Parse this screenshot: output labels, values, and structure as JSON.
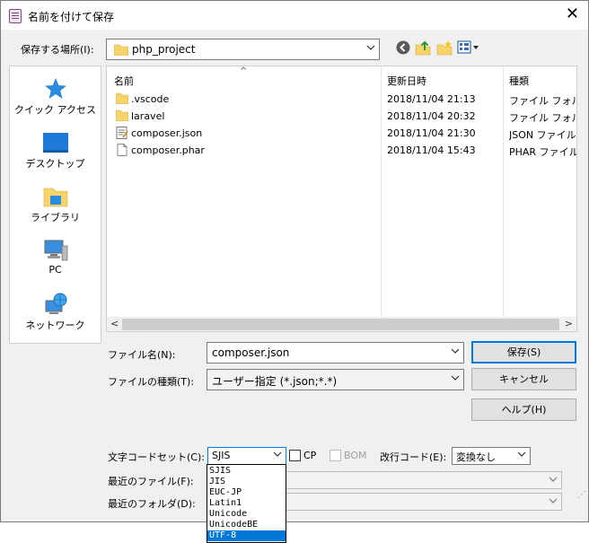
{
  "window": {
    "title": "名前を付けて保存",
    "close_glyph": "✕"
  },
  "location": {
    "label": "保存する場所(I):",
    "value": "php_project"
  },
  "places": [
    {
      "label": "クイック アクセス",
      "icon": "star-icon"
    },
    {
      "label": "デスクトップ",
      "icon": "desktop-icon"
    },
    {
      "label": "ライブラリ",
      "icon": "library-icon"
    },
    {
      "label": "PC",
      "icon": "computer-icon"
    },
    {
      "label": "ネットワーク",
      "icon": "network-icon"
    }
  ],
  "file_list": {
    "columns": [
      "名前",
      "更新日時",
      "種類"
    ],
    "rows": [
      {
        "name": ".vscode",
        "modified": "2018/11/04 21:13",
        "type": "ファイル フォルダー",
        "icon": "folder-icon"
      },
      {
        "name": "laravel",
        "modified": "2018/11/04 20:32",
        "type": "ファイル フォルダー",
        "icon": "folder-icon"
      },
      {
        "name": "composer.json",
        "modified": "2018/11/04 21:30",
        "type": "JSON ファイル",
        "icon": "json-file-icon"
      },
      {
        "name": "composer.phar",
        "modified": "2018/11/04 15:43",
        "type": "PHAR ファイル",
        "icon": "file-icon"
      }
    ]
  },
  "filename": {
    "label": "ファイル名(N):",
    "value": "composer.json"
  },
  "filetype": {
    "label": "ファイルの種類(T):",
    "value": "ユーザー指定 (*.json;*.*)"
  },
  "buttons": {
    "save": "保存(S)",
    "cancel": "キャンセル",
    "help": "ヘルプ(H)"
  },
  "charset": {
    "label": "文字コードセット(C):",
    "value": "SJIS",
    "options": [
      "SJIS",
      "JIS",
      "EUC-JP",
      "Latin1",
      "Unicode",
      "UnicodeBE",
      "UTF-8"
    ],
    "highlighted": "UTF-8"
  },
  "checkboxes": {
    "cp": "CP",
    "bom": "BOM"
  },
  "newline": {
    "label": "改行コード(E):",
    "value": "変換なし"
  },
  "recent_file": {
    "label": "最近のファイル(F):"
  },
  "recent_folder": {
    "label": "最近のフォルダ(D):"
  },
  "colors": {
    "accent": "#0078d7",
    "folder": "#f7d46b"
  }
}
